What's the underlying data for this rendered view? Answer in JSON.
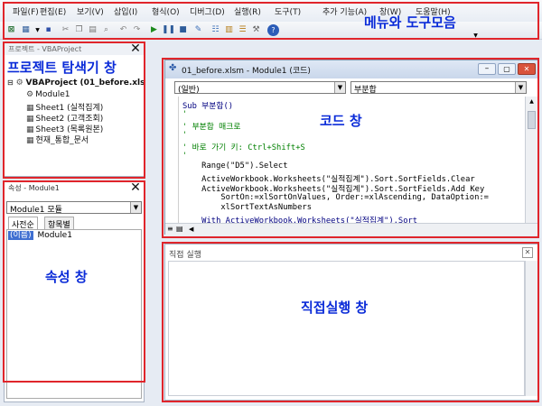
{
  "menu": {
    "items": [
      "파일(F)",
      "편집(E)",
      "보기(V)",
      "삽입(I)",
      "형식(O)",
      "디버그(D)",
      "실행(R)",
      "도구(T)",
      "추가 기능(A)",
      "창(W)",
      "도움말(H)"
    ]
  },
  "project": {
    "title": "프로젝트 - VBAProject",
    "root": "VBAProject (01_before.xls",
    "items": [
      "Module1",
      "Sheet1 (실적집계)",
      "Sheet2 (고객조회)",
      "Sheet3 (목록원본)",
      "현재_통합_문서"
    ]
  },
  "properties": {
    "title": "속성 - Module1",
    "object": "Module1 모듈",
    "tabs": [
      "사전순",
      "항목별"
    ],
    "row_name": "(이름)",
    "row_value": "Module1"
  },
  "code_window": {
    "title": "01_before.xlsm - Module1 (코드)",
    "object_select": "(일반)",
    "proc_select": "부분합",
    "lines": [
      {
        "text": "Sub 부분합()",
        "color": "#000080"
      },
      {
        "text": "'",
        "color": "#008000"
      },
      {
        "text": "' 부분합 매크로",
        "color": "#008000"
      },
      {
        "text": "'",
        "color": "#008000"
      },
      {
        "text": "' 바로 가기 키: Ctrl+Shift+S",
        "color": "#008000"
      },
      {
        "text": "'",
        "color": "#008000"
      },
      {
        "text": "    Range(\"D5\").Select",
        "color": "#000000"
      },
      {
        "text": "    ActiveWorkbook.Worksheets(\"실적집계\").Sort.SortFields.Clear",
        "color": "#000000"
      },
      {
        "text": "    ActiveWorkbook.Worksheets(\"실적집계\").Sort.SortFields.Add Key",
        "color": "#000000"
      },
      {
        "text": "        SortOn:=xlSortOnValues, Order:=xlAscending, DataOption:=",
        "color": "#000000"
      },
      {
        "text": "        xlSortTextAsNumbers",
        "color": "#000000"
      },
      {
        "text": "    With ActiveWorkbook.Worksheets(\"실적집계\").Sort",
        "color": "#000080"
      }
    ]
  },
  "immediate": {
    "title": "직접 실행"
  },
  "annotations": {
    "menu_toolbar": "메뉴와 도구모음",
    "project_explorer": "프로젝트 탐색기 창",
    "code": "코드 창",
    "properties": "속성 창",
    "immediate": "직접실행 창"
  },
  "colors": {
    "annotation_border": "#e0252b",
    "annotation_text": "#0a2bd8",
    "code_keyword": "#000080",
    "code_comment": "#008000"
  }
}
